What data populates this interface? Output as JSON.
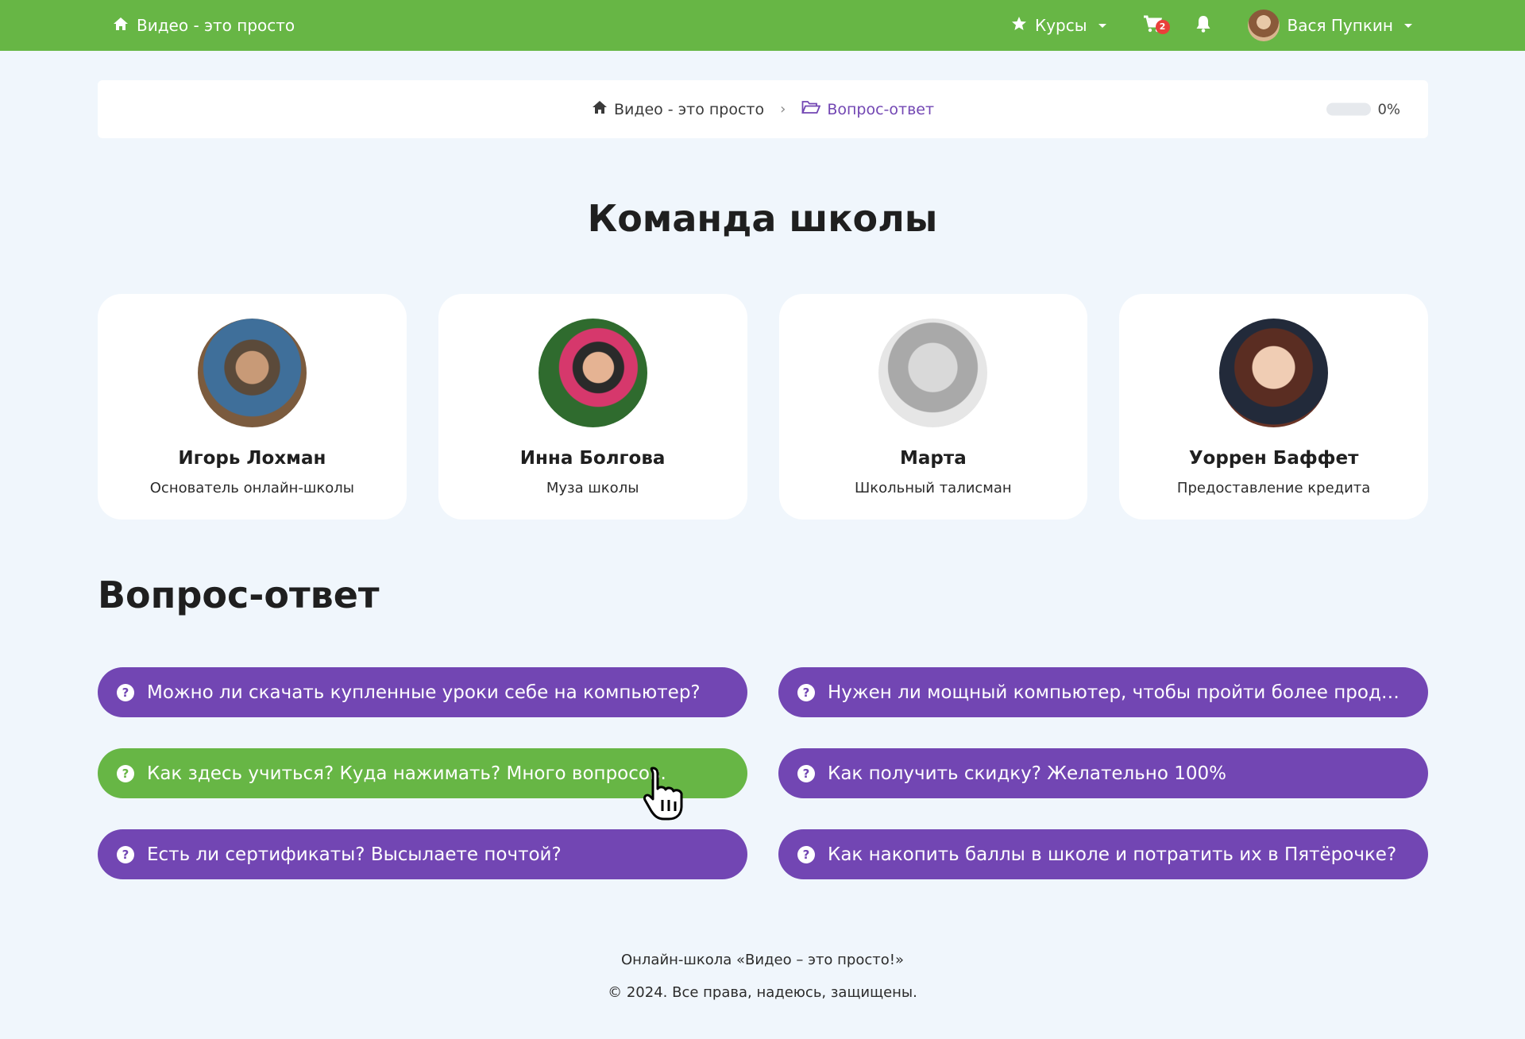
{
  "header": {
    "brand_label": "Видео - это просто",
    "courses_label": "Курсы",
    "cart_count": "2",
    "user_name": "Вася Пупкин",
    "accent_color": "#67b645"
  },
  "breadcrumb": {
    "home_label": "Видео - это просто",
    "current_label": "Вопрос-ответ",
    "progress_percent": 0,
    "progress_label": "0%"
  },
  "team": {
    "title": "Команда школы",
    "members": [
      {
        "name": "Игорь Лохман",
        "role": "Основатель онлайн-школы"
      },
      {
        "name": "Инна Болгова",
        "role": "Муза школы"
      },
      {
        "name": "Марта",
        "role": "Школьный талисман"
      },
      {
        "name": "Уоррен Баффет",
        "role": "Предоставление кредита"
      }
    ]
  },
  "faq": {
    "title": "Вопрос-ответ",
    "items": [
      {
        "text": "Можно ли скачать купленные уроки себе на компьютер?"
      },
      {
        "text": "Нужен ли мощный компьютер, чтобы пройти более продвинутые..."
      },
      {
        "text": "Как здесь учиться? Куда нажимать? Много вопросов."
      },
      {
        "text": "Как получить скидку? Желательно 100%"
      },
      {
        "text": "Есть ли сертификаты? Высылаете почтой?"
      },
      {
        "text": "Как накопить баллы в школе и потратить их в Пятёрочке?"
      }
    ],
    "item_color": "#7246b3",
    "hover_color": "#67b645"
  },
  "footer": {
    "line1": "Онлайн-школа «Видео – это просто!»",
    "line2": "© 2024. Все права, надеюсь, защищены."
  }
}
